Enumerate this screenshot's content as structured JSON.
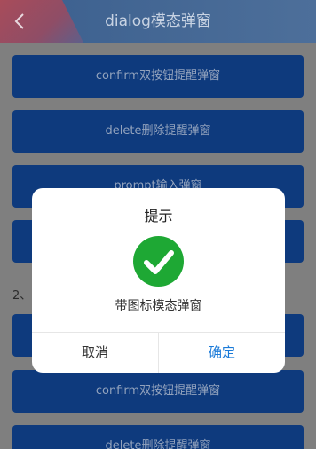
{
  "header": {
    "title": "dialog模态弹窗",
    "back_icon": "chevron-left-icon"
  },
  "buttons_top": [
    {
      "label": "confirm双按钮提醒弹窗"
    },
    {
      "label": "delete删除提醒弹窗"
    },
    {
      "label": "prompt输入弹窗"
    },
    {
      "label": ""
    }
  ],
  "section2": {
    "label": "2、"
  },
  "buttons_bottom": [
    {
      "label": ""
    },
    {
      "label": "confirm双按钮提醒弹窗"
    },
    {
      "label": "delete删除提醒弹窗"
    }
  ],
  "dialog": {
    "title": "提示",
    "icon": "check-circle-icon",
    "message": "带图标模态弹窗",
    "cancel_label": "取消",
    "ok_label": "确定"
  },
  "colors": {
    "button_bg": "#0e3a7d",
    "ok_text": "#1a7ad8",
    "success_green": "#1ea834"
  }
}
